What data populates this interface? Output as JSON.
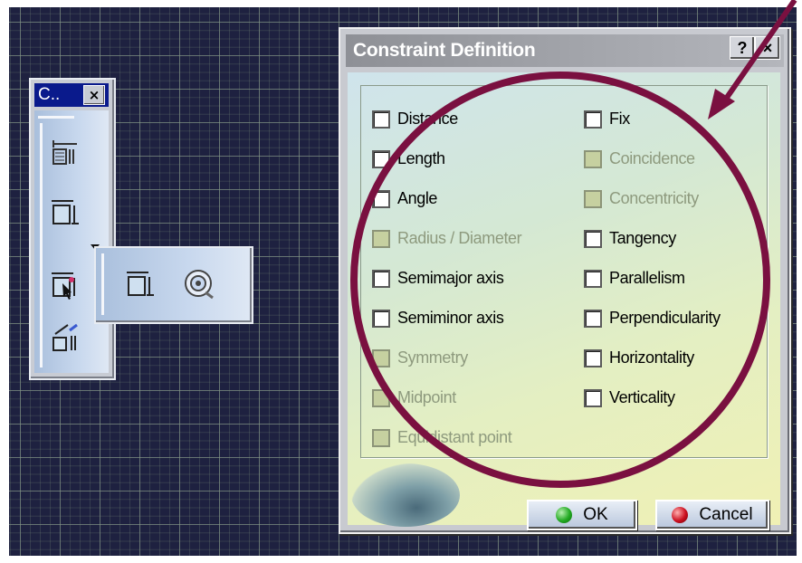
{
  "toolbar": {
    "title": "C..",
    "close_label": "×",
    "buttons": [
      "dimension-constraints-icon",
      "constraint-icon",
      "contact-constraint-icon",
      "auto-constraint-icon"
    ],
    "flyout_buttons": [
      "constraint-icon",
      "contact-constraint-icon"
    ]
  },
  "dialog": {
    "title": "Constraint Definition",
    "help_label": "?",
    "close_label": "×",
    "left_options": [
      {
        "label": "Distance",
        "enabled": true
      },
      {
        "label": "Length",
        "enabled": true
      },
      {
        "label": "Angle",
        "enabled": true
      },
      {
        "label": "Radius / Diameter",
        "enabled": false
      },
      {
        "label": "Semimajor axis",
        "enabled": true
      },
      {
        "label": "Semiminor axis",
        "enabled": true
      },
      {
        "label": "Symmetry",
        "enabled": false
      },
      {
        "label": "Midpoint",
        "enabled": false
      },
      {
        "label": "Equidistant point",
        "enabled": false
      }
    ],
    "right_options": [
      {
        "label": "Fix",
        "enabled": true
      },
      {
        "label": "Coincidence",
        "enabled": false
      },
      {
        "label": "Concentricity",
        "enabled": false
      },
      {
        "label": "Tangency",
        "enabled": true
      },
      {
        "label": "Parallelism",
        "enabled": true
      },
      {
        "label": "Perpendicularity",
        "enabled": true
      },
      {
        "label": "Horizontality",
        "enabled": true
      },
      {
        "label": "Verticality",
        "enabled": true
      }
    ],
    "ok_label": "OK",
    "cancel_label": "Cancel"
  },
  "colors": {
    "workspace_bg": "#1e2140",
    "annotation": "#7a1040",
    "ok_dot": "#22aa22",
    "cancel_dot": "#cc1020"
  }
}
